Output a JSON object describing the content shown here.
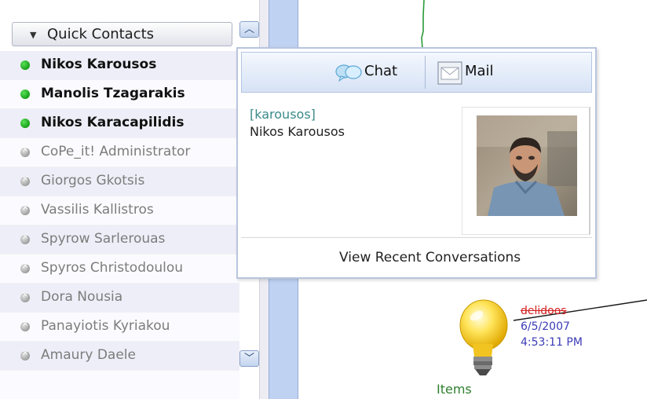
{
  "contacts": {
    "title": "Quick Contacts",
    "items": [
      {
        "name": "Nikos Karousos",
        "status": "online"
      },
      {
        "name": "Manolis Tzagarakis",
        "status": "online"
      },
      {
        "name": "Nikos Karacapilidis",
        "status": "online"
      },
      {
        "name": "CoPe_it! Administrator",
        "status": "offline"
      },
      {
        "name": "Giorgos Gkotsis",
        "status": "offline"
      },
      {
        "name": "Vassilis Kallistros",
        "status": "offline"
      },
      {
        "name": "Spyrow Sarlerouas",
        "status": "offline"
      },
      {
        "name": "Spyros Christodoulou",
        "status": "offline"
      },
      {
        "name": "Dora Nousia",
        "status": "offline"
      },
      {
        "name": "Panayiotis Kyriakou",
        "status": "offline"
      },
      {
        "name": "Amaury Daele",
        "status": "offline"
      }
    ]
  },
  "popup": {
    "chat_label": "Chat",
    "mail_label": "Mail",
    "username": "[karousos]",
    "fullname": "Nikos Karousos",
    "recent_label": "View Recent Conversations"
  },
  "canvas": {
    "node_user": "delidoos",
    "node_date": "6/5/2007",
    "node_time": "4:53:11 PM",
    "items_label": "Items"
  },
  "colors": {
    "online": "#22aa22",
    "offline": "#9a9a9a",
    "username": "#3a8a8a",
    "node_user": "#d42020",
    "node_date": "#3b3bb8"
  }
}
